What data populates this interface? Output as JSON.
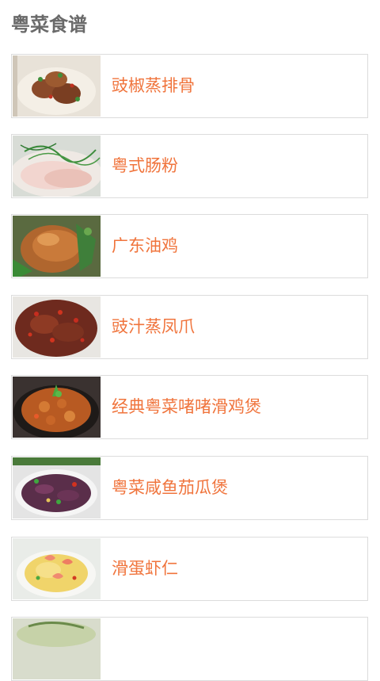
{
  "header": {
    "title": "粤菜食谱"
  },
  "recipes": [
    {
      "name": "豉椒蒸排骨",
      "image": "steamed-spare-ribs-photo"
    },
    {
      "name": "粤式肠粉",
      "image": "rice-noodle-roll-photo"
    },
    {
      "name": "广东油鸡",
      "image": "soy-sauce-chicken-photo"
    },
    {
      "name": "豉汁蒸凤爪",
      "image": "steamed-chicken-feet-photo"
    },
    {
      "name": "经典粤菜啫啫滑鸡煲",
      "image": "chicken-claypot-photo"
    },
    {
      "name": "粤菜咸鱼茄瓜煲",
      "image": "salted-fish-eggplant-claypot-photo"
    },
    {
      "name": "滑蛋虾仁",
      "image": "shrimp-scrambled-egg-photo"
    },
    {
      "name": "",
      "image": "partially-visible-dish-photo"
    }
  ]
}
